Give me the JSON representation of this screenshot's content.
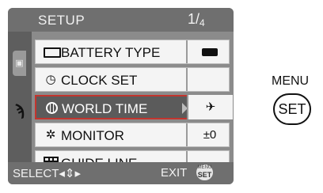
{
  "header": {
    "title": "SETUP",
    "page_current": "1",
    "page_total": "4"
  },
  "sidebar": {
    "camera_icon": "camera-icon",
    "wrench_icon": "wrench-icon"
  },
  "menu_items": [
    {
      "label": "BATTERY TYPE",
      "icon": "battery-icon",
      "value_icon": "battery-full-icon",
      "value": ""
    },
    {
      "label": "CLOCK SET",
      "icon": "clock-icon",
      "value": ""
    },
    {
      "label": "WORLD TIME",
      "icon": "globe-icon",
      "value": "✈",
      "selected": true
    },
    {
      "label": "MONITOR",
      "icon": "sun-icon",
      "value": "±0"
    },
    {
      "label": "GUIDE LINE",
      "icon": "grid-icon",
      "value": ""
    }
  ],
  "footer": {
    "select_label": "SELECT◂⇕▸",
    "exit_label": "EXIT",
    "menu_mini": "MENU",
    "set_mini": "SET"
  },
  "external_button": {
    "menu_label": "MENU",
    "set_label": "SET"
  },
  "colors": {
    "screen_bg": "#8b8b8b",
    "bar_bg": "#6f6f6f",
    "selection_border": "#c2352e"
  }
}
